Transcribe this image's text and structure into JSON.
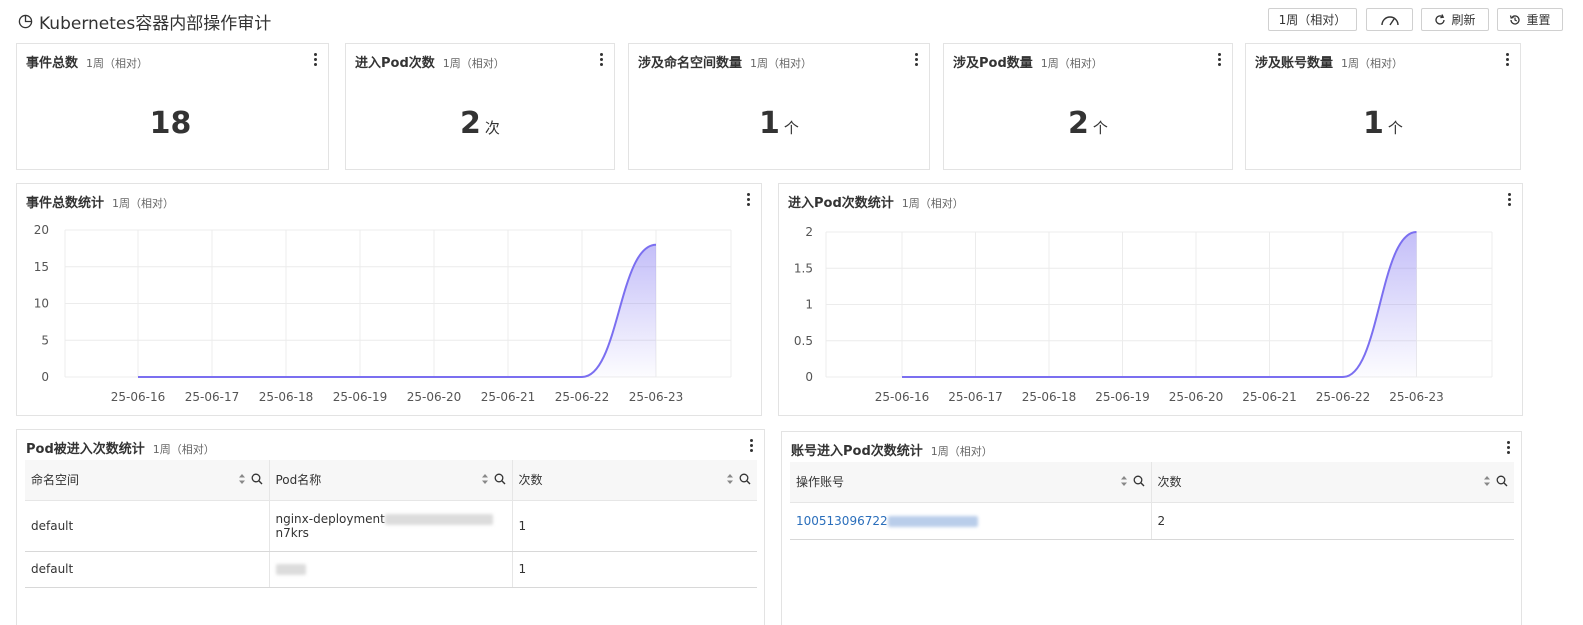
{
  "header": {
    "title": "Kubernetes容器内部操作审计",
    "time_button": "1周（相对）",
    "refresh_label": "刷新",
    "reset_label": "重置",
    "icons": [
      "pie-chart-icon",
      "speedometer-icon",
      "refresh-icon",
      "history-icon"
    ]
  },
  "metrics": [
    {
      "title": "事件总数",
      "range": "1周（相对）",
      "value": "18",
      "unit": ""
    },
    {
      "title": "进入Pod次数",
      "range": "1周（相对）",
      "value": "2",
      "unit": "次"
    },
    {
      "title": "涉及命名空间数量",
      "range": "1周（相对）",
      "value": "1",
      "unit": "个"
    },
    {
      "title": "涉及Pod数量",
      "range": "1周（相对）",
      "value": "2",
      "unit": "个"
    },
    {
      "title": "涉及账号数量",
      "range": "1周（相对）",
      "value": "1",
      "unit": "个"
    }
  ],
  "charts": {
    "events": {
      "title": "事件总数统计",
      "range": "1周（相对）"
    },
    "pod_entries": {
      "title": "进入Pod次数统计",
      "range": "1周（相对）"
    }
  },
  "chart_data": [
    {
      "type": "area",
      "x": [
        "25-06-16",
        "25-06-17",
        "25-06-18",
        "25-06-19",
        "25-06-20",
        "25-06-21",
        "25-06-22",
        "25-06-23"
      ],
      "series": [
        {
          "values": [
            0,
            0,
            0,
            0,
            0,
            0,
            0,
            18
          ]
        }
      ],
      "yticks": [
        "0",
        "5",
        "10",
        "15",
        "20"
      ],
      "ylim": [
        0,
        20
      ],
      "grid": true,
      "color": "#7b6ff0"
    },
    {
      "type": "area",
      "x": [
        "25-06-16",
        "25-06-17",
        "25-06-18",
        "25-06-19",
        "25-06-20",
        "25-06-21",
        "25-06-22",
        "25-06-23"
      ],
      "series": [
        {
          "values": [
            0,
            0,
            0,
            0,
            0,
            0,
            0,
            2
          ]
        }
      ],
      "yticks": [
        "0",
        "0.5",
        "1",
        "1.5",
        "2"
      ],
      "ylim": [
        0,
        2
      ],
      "grid": true,
      "color": "#7b6ff0"
    }
  ],
  "pod_table": {
    "title": "Pod被进入次数统计",
    "range": "1周（相对）",
    "columns": [
      "命名空间",
      "Pod名称",
      "次数"
    ],
    "rows": [
      {
        "namespace": "default",
        "pod": "nginx-deployment",
        "pod_suffix": "n7krs",
        "count": "1"
      },
      {
        "namespace": "default",
        "pod": "",
        "pod_suffix": "",
        "count": "1"
      }
    ]
  },
  "account_table": {
    "title": "账号进入Pod次数统计",
    "range": "1周（相对）",
    "columns": [
      "操作账号",
      "次数"
    ],
    "rows": [
      {
        "account": "100513096722",
        "count": "2"
      }
    ]
  },
  "colors": {
    "accent": "#7b6ff0",
    "link": "#2a6ebb",
    "border": "#e3e3e3"
  }
}
